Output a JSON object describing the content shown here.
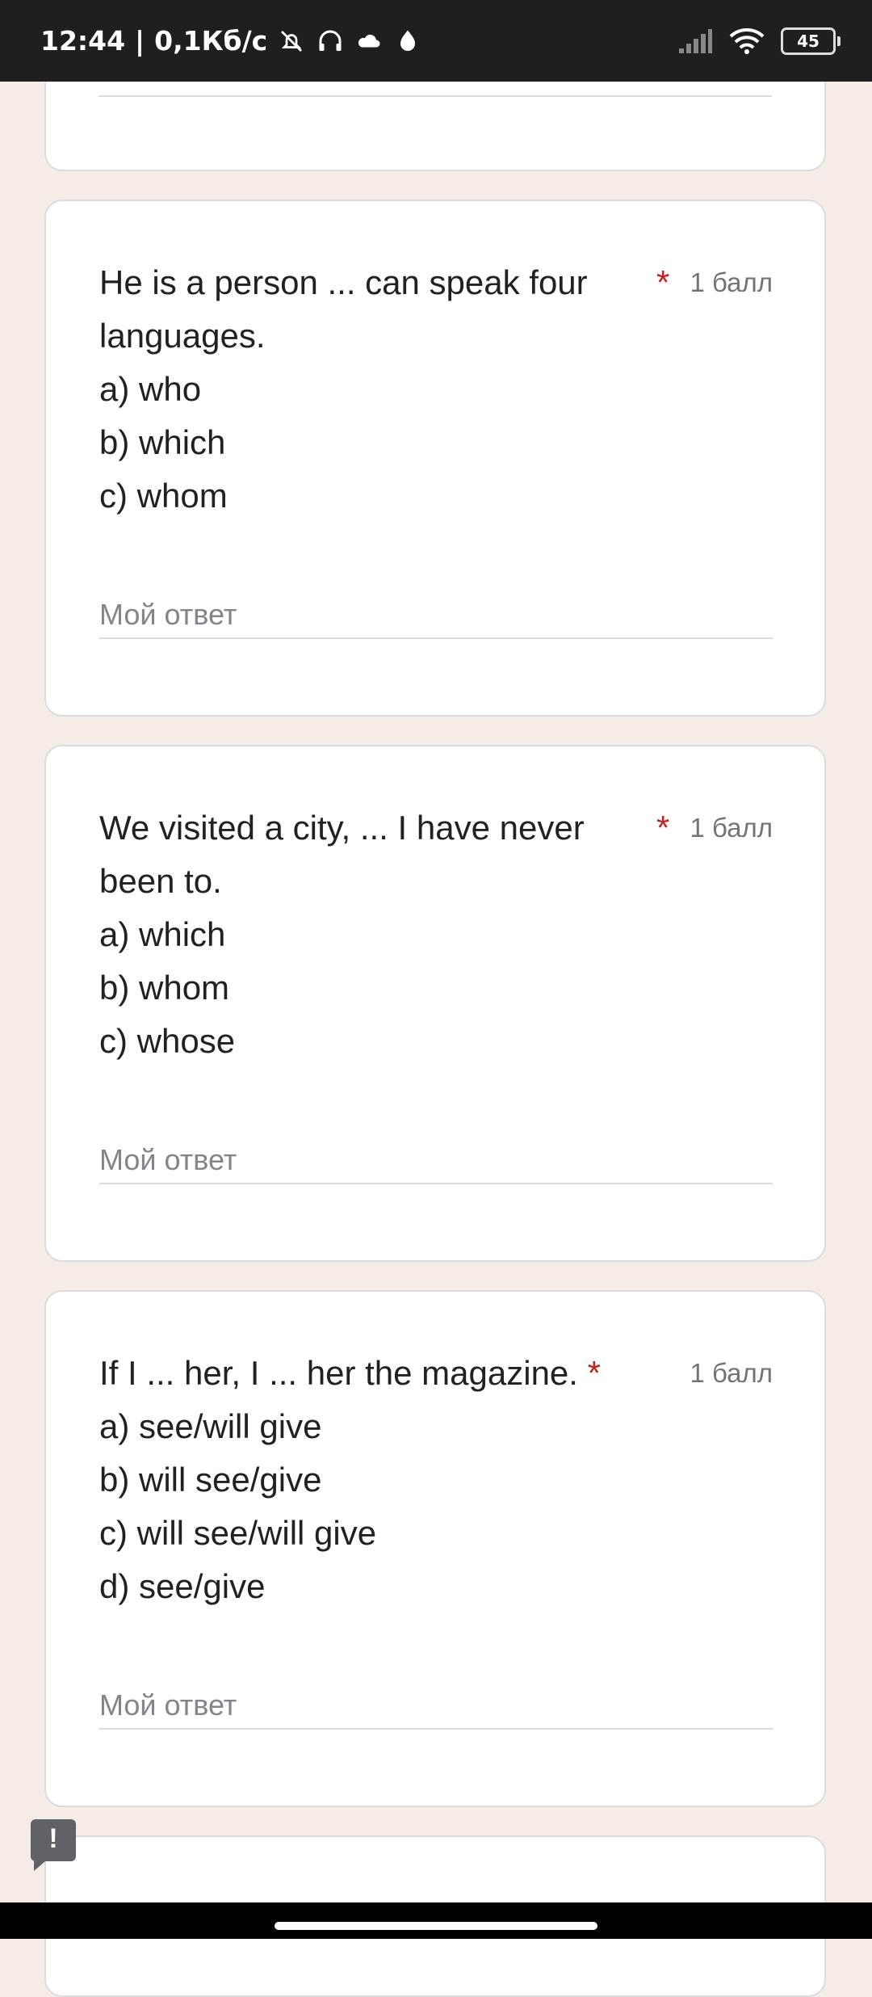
{
  "status_bar": {
    "time": "12:44",
    "separator": "|",
    "speed": "0,1Кб/с",
    "battery": "45",
    "icons": [
      "bell-off-icon",
      "headphones-icon",
      "cloud-icon",
      "drop-icon",
      "signal-icon",
      "wifi-icon",
      "battery-icon"
    ]
  },
  "questions": [
    {
      "lines": [
        "He is a person ... can speak four",
        "languages.",
        "a) who",
        "b) which",
        "c) whom"
      ],
      "required_mark": "*",
      "points": "1 балл",
      "answer_placeholder": "Мой ответ"
    },
    {
      "lines": [
        "We visited a city, ... I have never",
        "been to.",
        "a) which",
        "b) whom",
        "c) whose"
      ],
      "required_mark": "*",
      "points": "1 балл",
      "answer_placeholder": "Мой ответ"
    },
    {
      "lines": [
        "If I ... her, I ... her the magazine.",
        "a) see/will give",
        "b) will see/give",
        "c) will see/will give",
        "d) see/give"
      ],
      "required_mark": "*",
      "points": "1 балл",
      "answer_placeholder": "Мой ответ"
    }
  ],
  "feedback": {
    "label": "!"
  },
  "colors": {
    "background": "#f5ece6",
    "required": "#c5221f",
    "status_bar": "#1f1f1f"
  }
}
